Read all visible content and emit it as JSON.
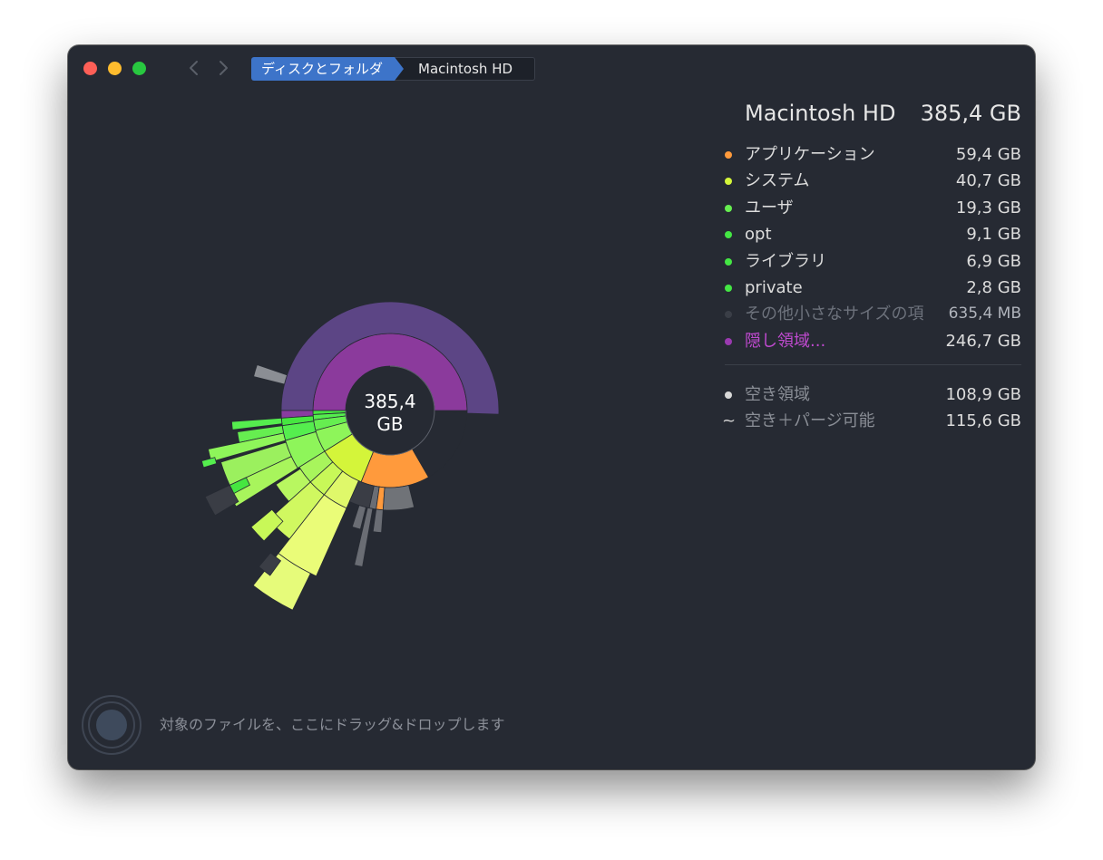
{
  "window": {
    "breadcrumb": [
      "ディスクとフォルダ",
      "Macintosh HD"
    ]
  },
  "chart_data": {
    "type": "sunburst",
    "center_label": [
      "385,4",
      "GB"
    ],
    "segments": [
      {
        "name": "アプリケーション",
        "size_gb": 59.4,
        "color": "#ff9a3c"
      },
      {
        "name": "システム",
        "size_gb": 40.7,
        "color": "#d4f53a"
      },
      {
        "name": "ユーザ",
        "size_gb": 19.3,
        "color": "#8ef55a"
      },
      {
        "name": "opt",
        "size_gb": 9.1,
        "color": "#55ee4e"
      },
      {
        "name": "ライブラリ",
        "size_gb": 6.9,
        "color": "#46e640"
      },
      {
        "name": "private",
        "size_gb": 2.8,
        "color": "#46e640"
      },
      {
        "name": "その他小さなサイズの項目",
        "size_gb": 0.6354,
        "color": "#3a3e47"
      },
      {
        "name": "隠し領域...",
        "size_gb": 246.7,
        "color": "#8b3a9c"
      }
    ]
  },
  "panel": {
    "title": "Macintosh HD",
    "total": "385,4 GB",
    "items": [
      {
        "name": "アプリケーション",
        "size": "59,4 GB",
        "color": "#ff9a3c"
      },
      {
        "name": "システム",
        "size": "40,7 GB",
        "color": "#d4f53a"
      },
      {
        "name": "ユーザ",
        "size": "19,3 GB",
        "color": "#66ee50"
      },
      {
        "name": "opt",
        "size": "9,1 GB",
        "color": "#44e644"
      },
      {
        "name": "ライブラリ",
        "size": "6,9 GB",
        "color": "#44e644"
      },
      {
        "name": "private",
        "size": "2,8 GB",
        "color": "#44e644"
      },
      {
        "name": "その他小さなサイズの項目",
        "size": "635,4  MB",
        "color": "#3a3e47"
      },
      {
        "name": "隠し領域...",
        "size": "246,7 GB",
        "color": "#9a3ab0"
      }
    ],
    "free": [
      {
        "name": "空き領域",
        "size": "108,9 GB",
        "icon": "dot",
        "color": "#d8d8d8"
      },
      {
        "name": "空き＋パージ可能",
        "size": "115,6 GB",
        "icon": "tilde"
      }
    ]
  },
  "footer": {
    "drop_hint": "対象のファイルを、ここにドラッグ&ドロップします"
  }
}
